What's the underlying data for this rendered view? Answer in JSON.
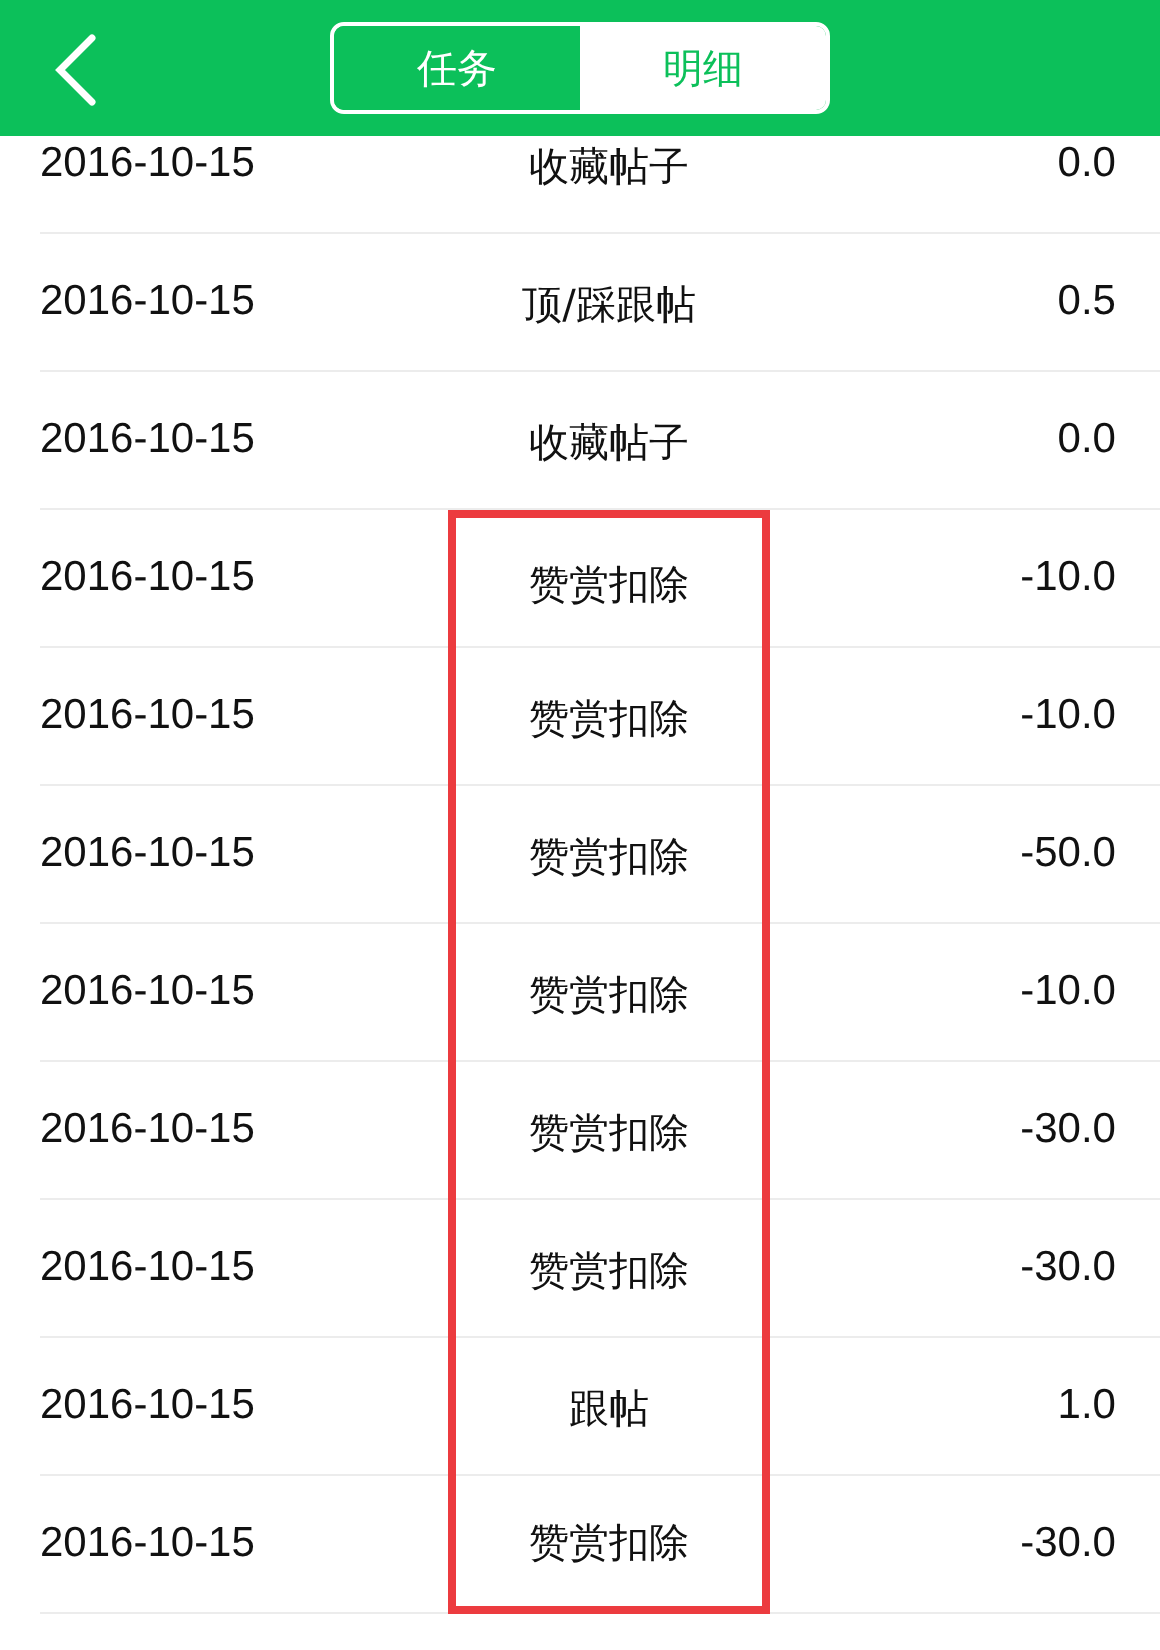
{
  "header": {
    "tabs": [
      {
        "label": "任务",
        "selected": false
      },
      {
        "label": "明细",
        "selected": true
      }
    ]
  },
  "rows": [
    {
      "date": "2016-10-15",
      "type": "收藏帖子",
      "amount": "0.0",
      "highlighted": false
    },
    {
      "date": "2016-10-15",
      "type": "顶/踩跟帖",
      "amount": "0.5",
      "highlighted": false
    },
    {
      "date": "2016-10-15",
      "type": "收藏帖子",
      "amount": "0.0",
      "highlighted": false
    },
    {
      "date": "2016-10-15",
      "type": "赞赏扣除",
      "amount": "-10.0",
      "highlighted": true
    },
    {
      "date": "2016-10-15",
      "type": "赞赏扣除",
      "amount": "-10.0",
      "highlighted": true
    },
    {
      "date": "2016-10-15",
      "type": "赞赏扣除",
      "amount": "-50.0",
      "highlighted": true
    },
    {
      "date": "2016-10-15",
      "type": "赞赏扣除",
      "amount": "-10.0",
      "highlighted": true
    },
    {
      "date": "2016-10-15",
      "type": "赞赏扣除",
      "amount": "-30.0",
      "highlighted": true
    },
    {
      "date": "2016-10-15",
      "type": "赞赏扣除",
      "amount": "-30.0",
      "highlighted": true
    },
    {
      "date": "2016-10-15",
      "type": "跟帖",
      "amount": "1.0",
      "highlighted": true
    },
    {
      "date": "2016-10-15",
      "type": "赞赏扣除",
      "amount": "-30.0",
      "highlighted": true
    }
  ]
}
